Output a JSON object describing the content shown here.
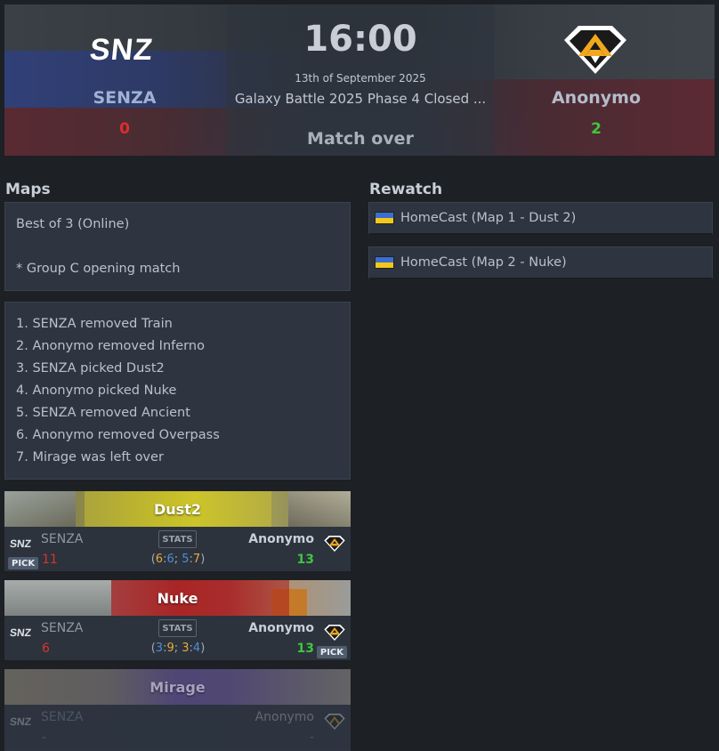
{
  "match": {
    "team_left": "SENZA",
    "team_right": "Anonymo",
    "logo_left_text": "SNZ",
    "score_left": "0",
    "score_right": "2",
    "time": "16:00",
    "date": "13th of September 2025",
    "event": "Galaxy Battle 2025 Phase 4 Closed ...",
    "status": "Match over"
  },
  "maps_section": {
    "title": "Maps",
    "format_line": "Best of 3 (Online)",
    "note_line": "* Group C opening match",
    "veto": [
      "1. SENZA removed Train",
      "2. Anonymo removed Inferno",
      "3. SENZA picked Dust2",
      "4. Anonymo picked Nuke",
      "5. SENZA removed Ancient",
      "6. Anonymo removed Overpass",
      "7. Mirage was left over"
    ]
  },
  "rewatch": {
    "title": "Rewatch",
    "items": [
      "HomeCast (Map 1 - Dust 2)",
      "HomeCast (Map 2 - Nuke)"
    ]
  },
  "map_cards": [
    {
      "name": "Dust2",
      "team_left": "SENZA",
      "team_right": "Anonymo",
      "score_left": "11",
      "score_right": "13",
      "stats_label": "STATS",
      "half_open": "(",
      "h1a": "6",
      "sep1": ":",
      "h1b": "6",
      "semi": "; ",
      "h2a": "5",
      "sep2": ":",
      "h2b": "7",
      "half_close": ")",
      "pick_label": "PICK",
      "pick_side": "left"
    },
    {
      "name": "Nuke",
      "team_left": "SENZA",
      "team_right": "Anonymo",
      "score_left": "6",
      "score_right": "13",
      "stats_label": "STATS",
      "half_open": "(",
      "h1a": "3",
      "sep1": ":",
      "h1b": "9",
      "semi": "; ",
      "h2a": "3",
      "sep2": ":",
      "h2b": "4",
      "half_close": ")",
      "pick_label": "PICK",
      "pick_side": "right"
    },
    {
      "name": "Mirage",
      "team_left": "SENZA",
      "team_right": "Anonymo",
      "score_left": "-",
      "score_right": "-"
    }
  ],
  "colors": {
    "background": "#1d2024",
    "panel": "#2e3540",
    "win": "#3fc63f",
    "loss": "#e02d2d",
    "ct_half": "#e8a93a",
    "t_half": "#4e8fd8"
  },
  "icons": {
    "left_team_logo": "senza-logo",
    "right_team_logo": "anonymo-logo",
    "rewatch_flag": "ukraine-flag-icon"
  }
}
